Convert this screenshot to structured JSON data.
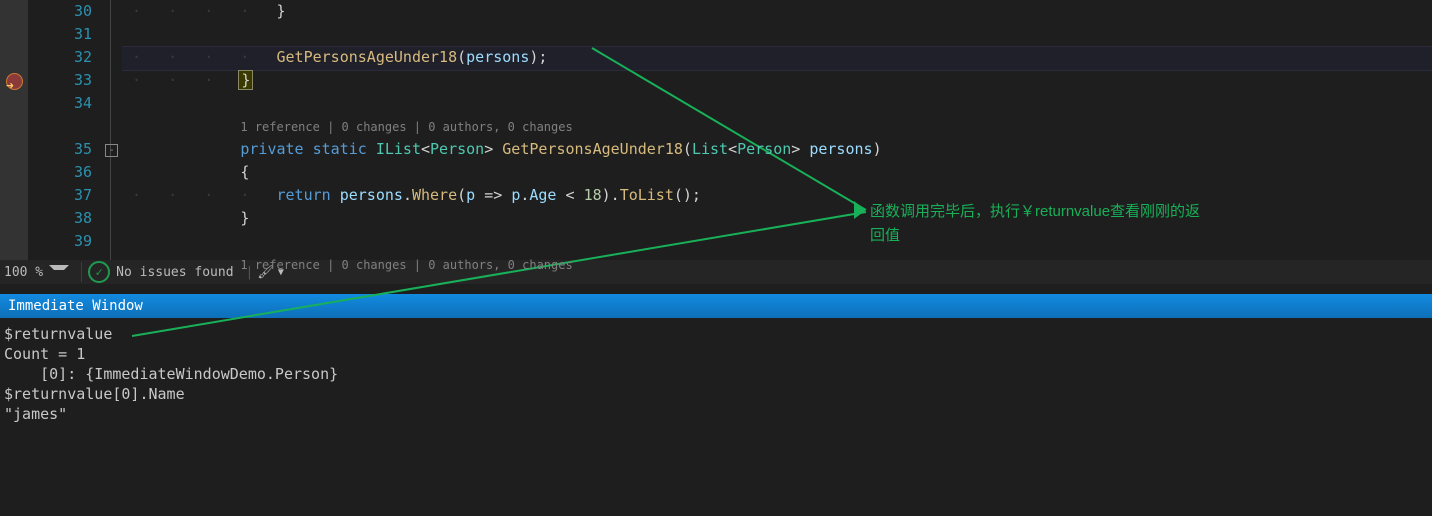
{
  "editor": {
    "lines": [
      {
        "num": "30"
      },
      {
        "num": "31"
      },
      {
        "num": "32",
        "call_method": "GetPersonsAgeUnder18",
        "call_arg": "persons"
      },
      {
        "num": "33",
        "brace": "}"
      },
      {
        "num": "34"
      },
      {
        "codelens": "1 reference | 0 changes | 0 authors, 0 changes"
      },
      {
        "num": "35",
        "kw1": "private",
        "kw2": "static",
        "ret": "IList",
        "gen1": "Person",
        "method": "GetPersonsAgeUnder18",
        "ptype": "List",
        "gen2": "Person",
        "pname": "persons"
      },
      {
        "num": "36",
        "open": "{"
      },
      {
        "num": "37",
        "kw": "return",
        "id": "persons",
        "where": "Where",
        "lam_p": "p",
        "lam_age": "Age",
        "op_num": "18",
        "tolist": "ToList"
      },
      {
        "num": "38",
        "close": "}"
      },
      {
        "num": "39"
      },
      {
        "codelens": "1 reference | 0 changes | 0 authors, 0 changes"
      }
    ]
  },
  "status": {
    "zoom": "100 %",
    "issues": "No issues found"
  },
  "immediate": {
    "title": "Immediate Window",
    "l1": "$returnvalue",
    "l2": "Count = 1",
    "l3": "    [0]: {ImmediateWindowDemo.Person}",
    "l4": "$returnvalue[0].Name",
    "l5": "\"james\""
  },
  "annotation": {
    "line1": "函数调用完毕后，执行￥returnvalue查看刚刚的返",
    "line2": "回值"
  }
}
